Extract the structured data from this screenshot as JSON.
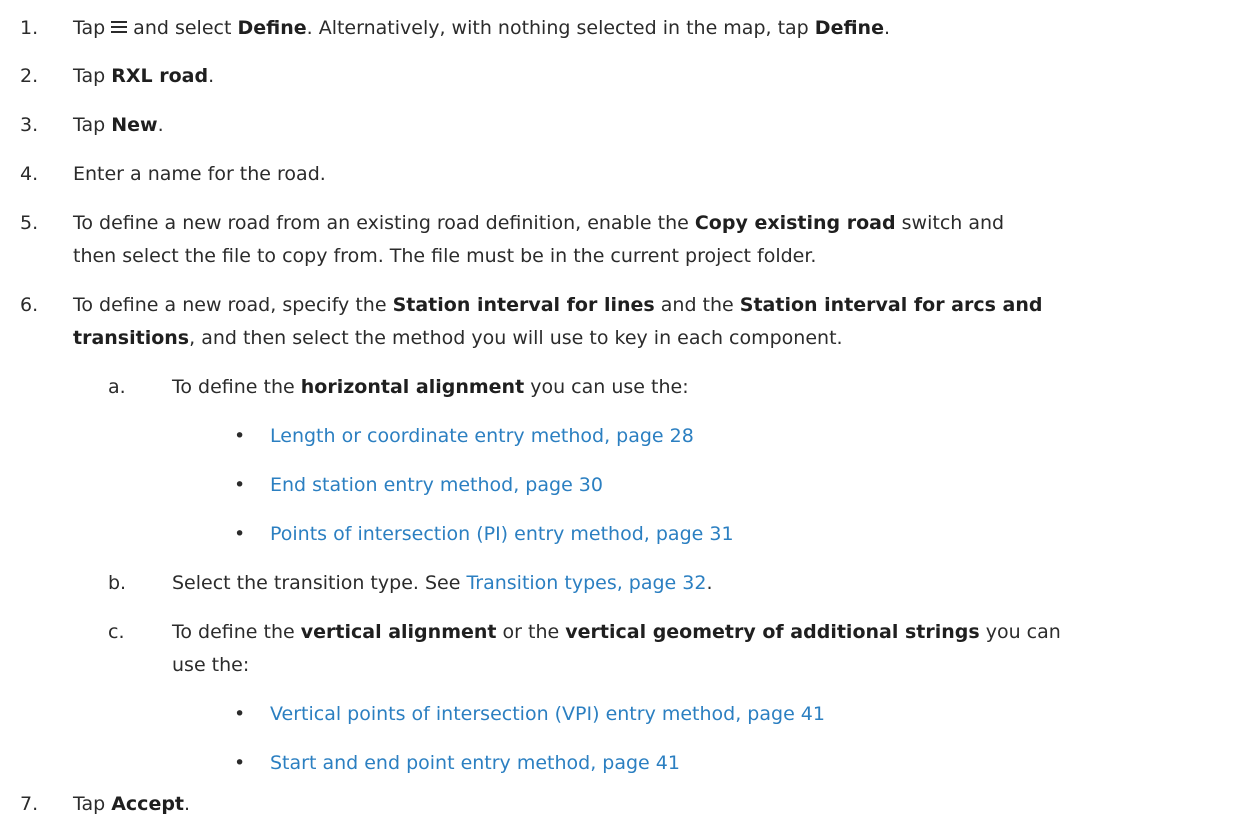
{
  "steps": [
    {
      "num": "1.",
      "pre": "Tap",
      "mid": "and select",
      "b1": "Define",
      "mid2": ". Alternatively, with nothing selected in the map, tap",
      "b2": "Define",
      "post": "."
    },
    {
      "num": "2.",
      "pre": "Tap",
      "b1": "RXL road",
      "post": "."
    },
    {
      "num": "3.",
      "pre": "Tap",
      "b1": "New",
      "post": "."
    },
    {
      "num": "4.",
      "text": "Enter a name for the road."
    },
    {
      "num": "5.",
      "pre": "To define a new road from an existing road definition, enable the",
      "b1": "Copy existing road",
      "post": "switch and",
      "line2": "then select the file to copy from. The file must be in the current project folder."
    },
    {
      "num": "6.",
      "pre": "To define a new road, specify the",
      "b1": "Station interval for lines",
      "mid": "and the",
      "b2": "Station interval for arcs and",
      "b3": "transitions",
      "post": ", and then select the method you will use to key in each component."
    },
    {
      "num": "7.",
      "pre": "Tap",
      "b1": "Accept",
      "post": "."
    }
  ],
  "substeps": {
    "a": {
      "label": "a.",
      "pre": "To define the",
      "b1": "horizontal alignment",
      "post": "you can use the:",
      "links": [
        "Length or coordinate entry method, page 28",
        "End station entry method, page 30",
        "Points of intersection (PI) entry method, page 31"
      ]
    },
    "b": {
      "label": "b.",
      "pre": "Select the transition type. See",
      "link": "Transition types, page 32",
      "post": "."
    },
    "c": {
      "label": "c.",
      "pre": "To define the",
      "b1": "vertical alignment",
      "mid": "or the",
      "b2": "vertical geometry of additional strings",
      "post": "you can",
      "line2": "use the:",
      "links": [
        "Vertical points of intersection (VPI) entry method, page 41",
        "Start and end point entry method, page 41"
      ]
    }
  },
  "icons": {
    "menu": "hamburger-menu-icon"
  },
  "colors": {
    "link": "#2b7fc1",
    "text": "#2b2b2b"
  }
}
